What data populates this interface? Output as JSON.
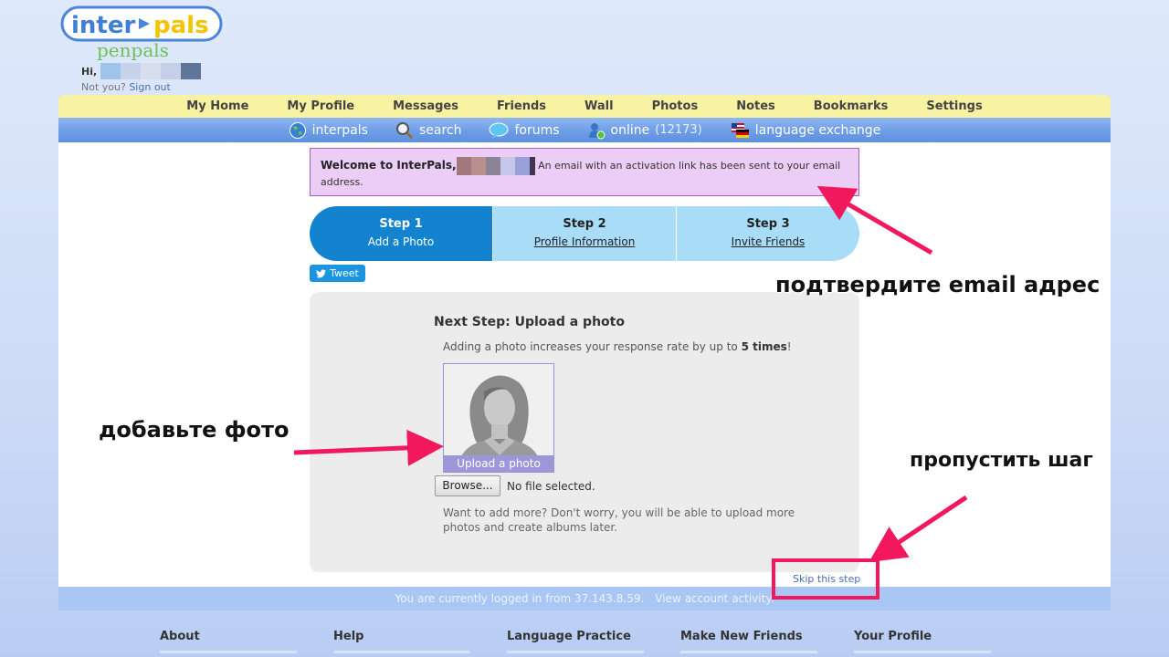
{
  "header": {
    "logo_text": "inter pals",
    "logo_sub": "penpals",
    "greeting": "Hi,",
    "not_you": "Not you?",
    "sign_out": "Sign out"
  },
  "nav": {
    "main": [
      "My Home",
      "My Profile",
      "Messages",
      "Friends",
      "Wall",
      "Photos",
      "Notes",
      "Bookmarks",
      "Settings"
    ],
    "sub": {
      "interpals": "interpals",
      "search": "search",
      "forums": "forums",
      "online": "online",
      "online_count": "(12173)",
      "language_exchange": "language exchange"
    }
  },
  "welcome": {
    "title": "Welcome to InterPals,",
    "message": "An email with an activation link has been sent to your email address."
  },
  "steps": [
    {
      "title": "Step 1",
      "subtitle": "Add a Photo",
      "active": true
    },
    {
      "title": "Step 2",
      "subtitle": "Profile Information",
      "active": false
    },
    {
      "title": "Step 3",
      "subtitle": "Invite Friends",
      "active": false
    }
  ],
  "tweet_label": "Tweet",
  "upload": {
    "title": "Next Step: Upload a photo",
    "desc_pre": "Adding a photo increases your response rate by up to ",
    "desc_bold": "5 times",
    "desc_post": "!",
    "upload_label": "Upload a photo",
    "browse_label": "Browse...",
    "file_status": "No file selected.",
    "more_info": "Want to add more? Don't worry, you will be able to upload more photos and create albums later.",
    "skip_label": "Skip this step"
  },
  "footer": {
    "logged_text": "You are currently logged in from 37.143.8.59.",
    "activity_link": "View account activity.",
    "columns": [
      "About",
      "Help",
      "Language Practice",
      "Make New Friends",
      "Your Profile"
    ]
  },
  "annotations": {
    "confirm_email": "подтвердите email адрес",
    "add_photo": "добавьте фото",
    "skip_step": "пропустить шаг"
  },
  "colors": {
    "accent": "#1383cf",
    "arrow": "#f2185e",
    "nav_yellow": "#f7f3a2",
    "welcome_bg": "#ebcdf5"
  },
  "icons": {
    "interpals": "globe-icon",
    "search": "magnifier-icon",
    "forums": "speech-bubble-icon",
    "online": "person-online-icon",
    "language_exchange": "flags-icon",
    "tweet": "twitter-bird-icon"
  }
}
